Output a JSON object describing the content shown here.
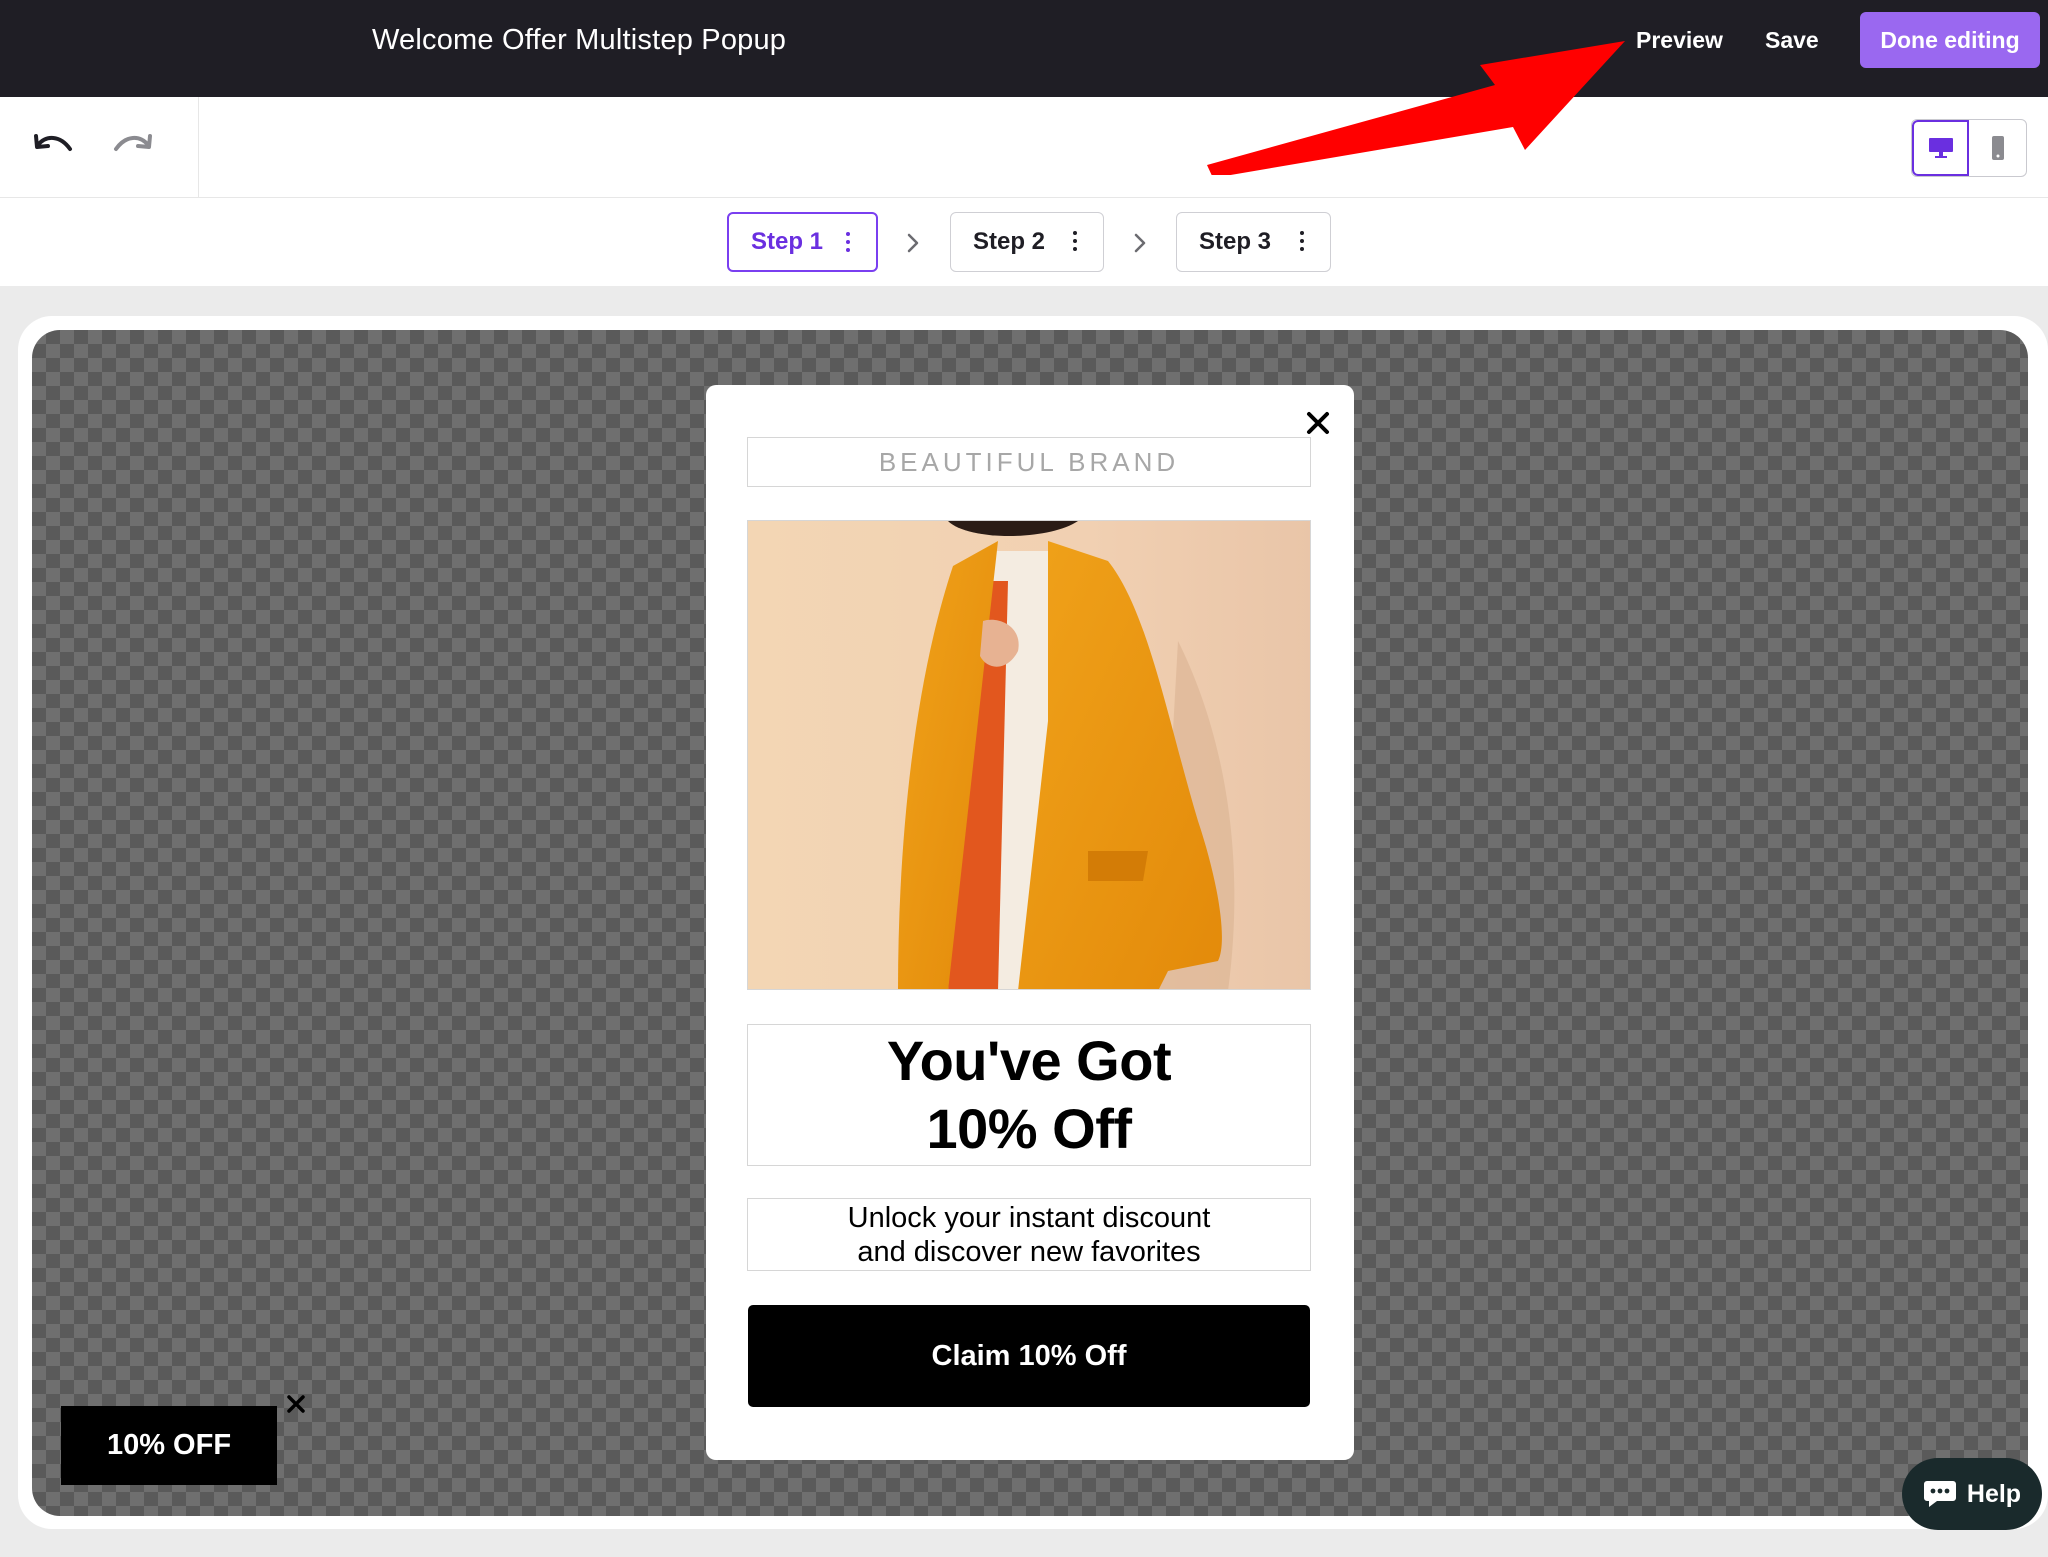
{
  "header": {
    "title": "Welcome Offer Multistep Popup",
    "preview_label": "Preview",
    "save_label": "Save",
    "done_label": "Done editing"
  },
  "toolbar": {
    "undo_icon": "undo-icon",
    "redo_icon": "redo-icon",
    "devices": [
      {
        "name": "desktop-icon",
        "active": true
      },
      {
        "name": "mobile-icon",
        "active": false
      }
    ]
  },
  "steps": [
    {
      "label": "Step 1",
      "active": true
    },
    {
      "label": "Step 2",
      "active": false
    },
    {
      "label": "Step 3",
      "active": false
    }
  ],
  "popup": {
    "brand": "BEAUTIFUL BRAND",
    "heading_line1": "You've Got",
    "heading_line2": "10% Off",
    "sub_line1": "Unlock your instant discount",
    "sub_line2": "and discover new favorites",
    "button_label": "Claim 10% Off"
  },
  "teaser": {
    "label": "10% OFF"
  },
  "help": {
    "label": "Help"
  },
  "colors": {
    "topbar": "#1f1e25",
    "accent": "#9a68f0",
    "step_active": "#6a2fe0",
    "annotation_arrow": "#ff0000"
  }
}
